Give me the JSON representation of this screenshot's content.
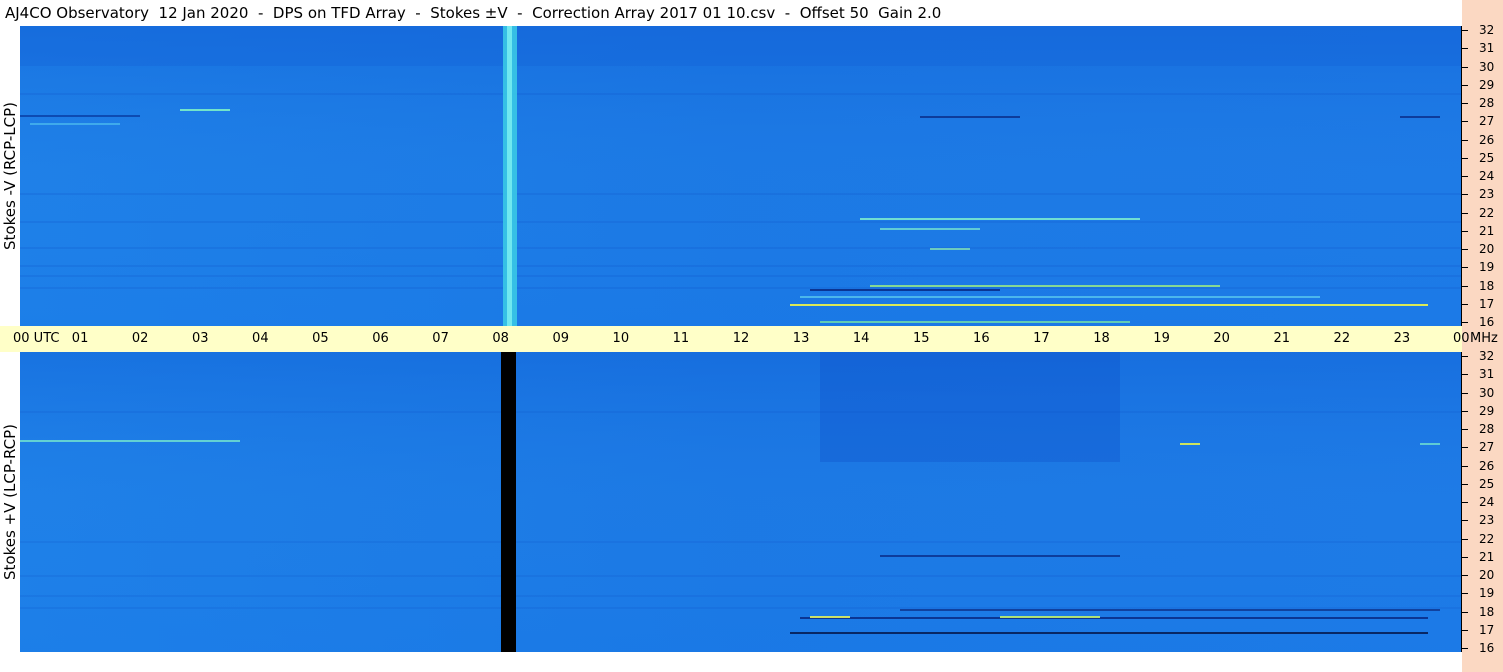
{
  "title": "AJ4CO Observatory  12 Jan 2020  -  DPS on TFD Array  -  Stokes ±V  -  Correction Array 2017 01 10.csv  -  Offset 50  Gain 2.0",
  "panels": {
    "top": {
      "label": "Stokes -V (RCP-LCP)"
    },
    "bottom": {
      "label": "Stokes +V (LCP-RCP)"
    }
  },
  "time_axis": {
    "labels": [
      "00 UTC",
      "01",
      "02",
      "03",
      "04",
      "05",
      "06",
      "07",
      "08",
      "09",
      "10",
      "11",
      "12",
      "13",
      "14",
      "15",
      "16",
      "17",
      "18",
      "19",
      "20",
      "21",
      "22",
      "23",
      "00"
    ],
    "unit": "MHz"
  },
  "freq_axis": {
    "labels": [
      "32",
      "31",
      "30",
      "29",
      "28",
      "27",
      "26",
      "25",
      "24",
      "23",
      "22",
      "21",
      "20",
      "19",
      "18",
      "17",
      "16"
    ]
  },
  "colors": {
    "background_blue": "#1e78e6",
    "strip": "#fbd8c2",
    "timebar": "#ffffc8"
  }
}
